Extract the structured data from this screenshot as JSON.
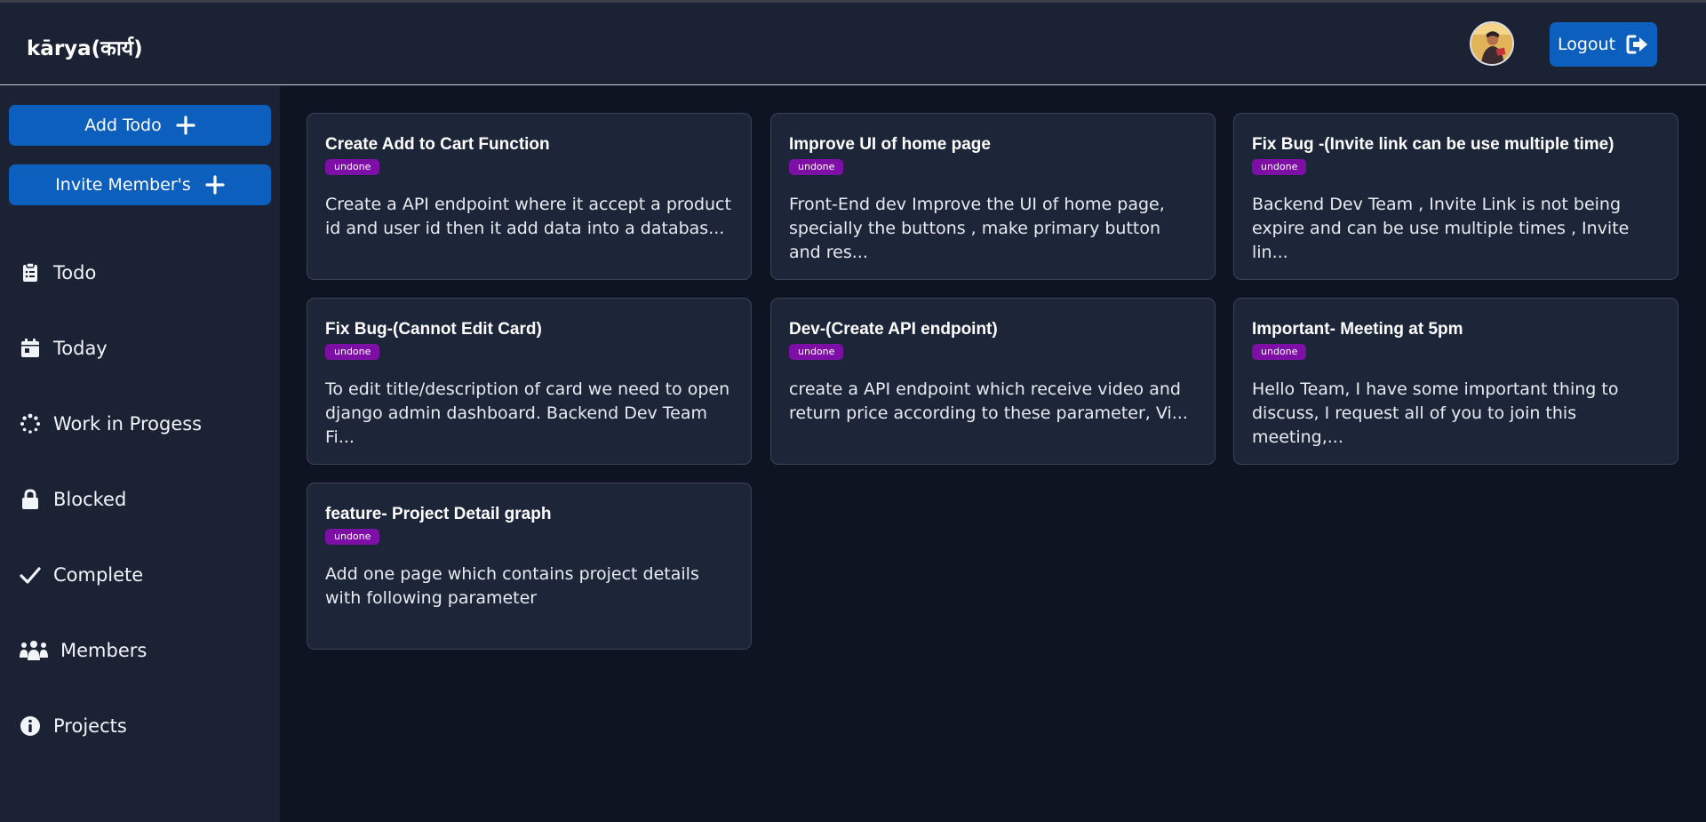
{
  "header": {
    "brand": "kārya(कार्य)",
    "logout_label": "Logout"
  },
  "sidebar": {
    "add_todo_label": "Add Todo",
    "invite_members_label": "Invite Member's",
    "items": [
      {
        "label": "Todo",
        "icon": "clipboard-list-icon"
      },
      {
        "label": "Today",
        "icon": "calendar-day-icon"
      },
      {
        "label": "Work in Progess",
        "icon": "spinner-icon"
      },
      {
        "label": "Blocked",
        "icon": "lock-icon"
      },
      {
        "label": "Complete",
        "icon": "check-icon"
      },
      {
        "label": "Members",
        "icon": "users-icon"
      },
      {
        "label": "Projects",
        "icon": "info-circle-icon"
      }
    ]
  },
  "cards": [
    {
      "title": "Create Add to Cart Function",
      "status": "undone",
      "description": "Create a API endpoint where it accept a product id and user id then it add data into a databas..."
    },
    {
      "title": "Improve UI of home page",
      "status": "undone",
      "description": "Front-End dev Improve the UI of home page, specially the buttons , make primary button and res..."
    },
    {
      "title": "Fix Bug -(Invite link can be use multiple time)",
      "status": "undone",
      "description": "Backend Dev Team , Invite Link is not being expire and can be use multiple times , Invite lin..."
    },
    {
      "title": "Fix Bug-(Cannot Edit Card)",
      "status": "undone",
      "description": "To edit title/description of card we need to open django admin dashboard. Backend Dev Team Fi..."
    },
    {
      "title": "Dev-(Create API endpoint)",
      "status": "undone",
      "description": "create a API endpoint which receive video and return price according to these parameter, Vi..."
    },
    {
      "title": "Important- Meeting at 5pm",
      "status": "undone",
      "description": "Hello Team, I have some important thing to discuss, I request all of you to join this meeting,..."
    },
    {
      "title": "feature- Project Detail graph",
      "status": "undone",
      "description": "Add one page which contains project details with following parameter"
    }
  ],
  "colors": {
    "background": "#0f1423",
    "panel": "#1b2233",
    "card": "#1d2638",
    "primary": "#0c5fbd",
    "badge": "#7e0fa6"
  }
}
